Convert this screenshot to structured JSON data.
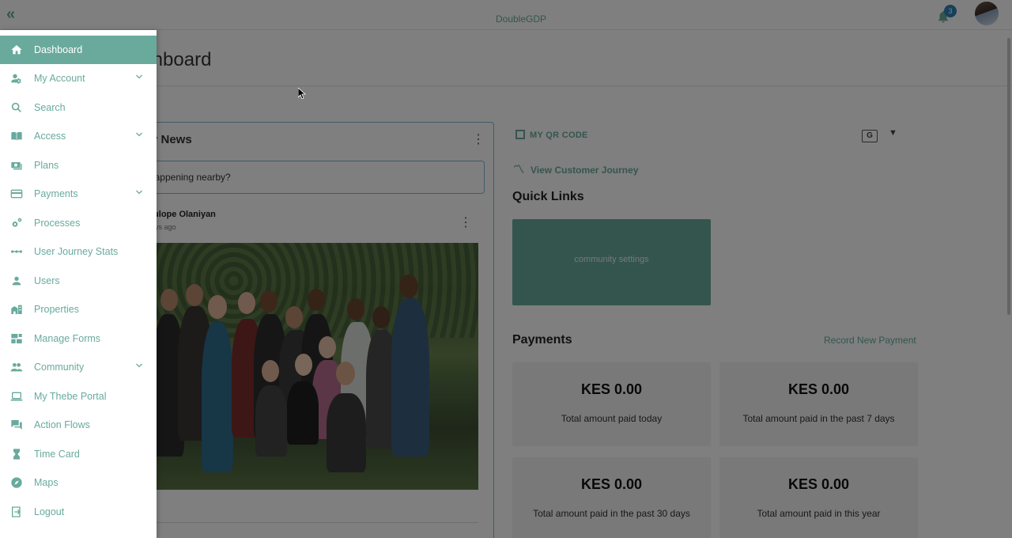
{
  "app": {
    "brand": "DoubleGDP",
    "notification_count": "3"
  },
  "page": {
    "title": "Dashboard"
  },
  "news": {
    "title": "Community News",
    "visible_title": "y News",
    "input_placeholder": "What's happening nearby?",
    "visible_placeholder": "t's happening nearby?",
    "post_author": "lulope Olaniyan",
    "post_time": "ays ago"
  },
  "links": {
    "qr_code": "MY QR CODE",
    "customer_journey": "View Customer Journey"
  },
  "quick_links": {
    "title": "Quick Links",
    "tiles": [
      {
        "label": "community settings"
      }
    ]
  },
  "payments": {
    "title": "Payments",
    "record_label": "Record New Payment",
    "stats": [
      {
        "amount": "KES 0.00",
        "label": "Total amount paid today"
      },
      {
        "amount": "KES 0.00",
        "label": "Total amount paid in the past 7 days"
      },
      {
        "amount": "KES 0.00",
        "label": "Total amount paid in the past 30 days"
      },
      {
        "amount": "KES 0.00",
        "label": "Total amount paid in this year"
      }
    ]
  },
  "sidebar": {
    "items": [
      {
        "label": "Dashboard",
        "icon": "home-icon",
        "active": true
      },
      {
        "label": "My Account",
        "icon": "account-settings-icon",
        "expandable": true
      },
      {
        "label": "Search",
        "icon": "search-icon"
      },
      {
        "label": "Access",
        "icon": "book-icon",
        "expandable": true
      },
      {
        "label": "Plans",
        "icon": "money-icon"
      },
      {
        "label": "Payments",
        "icon": "credit-card-icon",
        "expandable": true
      },
      {
        "label": "Processes",
        "icon": "gears-icon"
      },
      {
        "label": "User Journey Stats",
        "icon": "timeline-icon"
      },
      {
        "label": "Users",
        "icon": "person-icon"
      },
      {
        "label": "Properties",
        "icon": "buildings-icon"
      },
      {
        "label": "Manage Forms",
        "icon": "forms-icon"
      },
      {
        "label": "Community",
        "icon": "group-icon",
        "expandable": true
      },
      {
        "label": "My Thebe Portal",
        "icon": "laptop-icon"
      },
      {
        "label": "Action Flows",
        "icon": "chat-icon"
      },
      {
        "label": "Time Card",
        "icon": "hourglass-icon"
      },
      {
        "label": "Maps",
        "icon": "compass-icon"
      },
      {
        "label": "Logout",
        "icon": "logout-icon"
      }
    ]
  },
  "colors": {
    "accent": "#69aa9d",
    "overlay": "rgba(0,0,0,0.5)",
    "badge": "#2f80b5"
  }
}
